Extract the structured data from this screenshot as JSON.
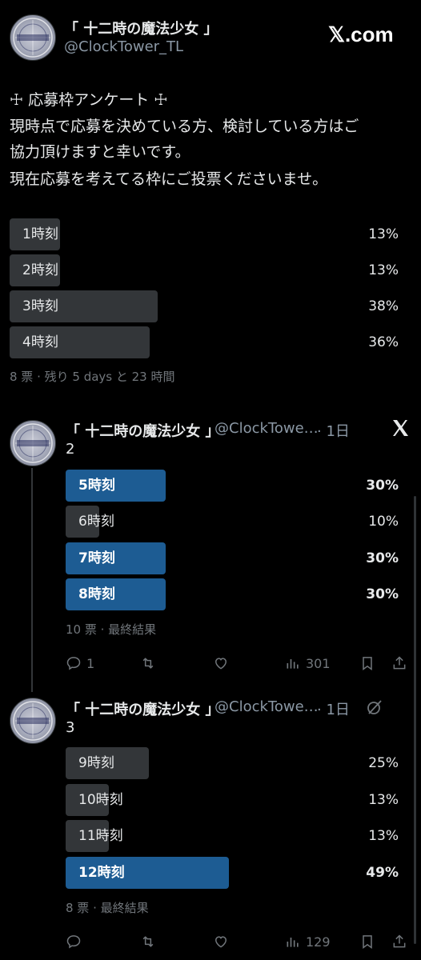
{
  "main_tweet": {
    "display_name": "「 十二時の魔法少女 」",
    "handle": "@ClockTower_TL",
    "brand": "𝕏.com",
    "text_lines": [
      "☩ 応募枠アンケート ☩",
      "現時点で応募を決めている方、検討している方はご",
      "協力頂けますと幸いです。",
      "現在応募を考えてる枠にご投票くださいませ。"
    ],
    "poll": [
      {
        "label": "1時刻",
        "percent": "13%",
        "value": 13
      },
      {
        "label": "2時刻",
        "percent": "13%",
        "value": 13
      },
      {
        "label": "3時刻",
        "percent": "38%",
        "value": 38
      },
      {
        "label": "4時刻",
        "percent": "36%",
        "value": 36
      }
    ],
    "poll_meta": "8 票 · 残り 5 days と 23 時間"
  },
  "reply1": {
    "display_name": "「 十二時の魔法少女 」",
    "handle": "@ClockTowe…",
    "time": "· 1日",
    "text": "2",
    "poll": [
      {
        "label": "5時刻",
        "percent": "30%",
        "value": 30,
        "winner": true
      },
      {
        "label": "6時刻",
        "percent": "10%",
        "value": 10,
        "winner": false
      },
      {
        "label": "7時刻",
        "percent": "30%",
        "value": 30,
        "winner": true
      },
      {
        "label": "8時刻",
        "percent": "30%",
        "value": 30,
        "winner": true
      }
    ],
    "poll_meta": "10 票 · 最終結果",
    "actions": {
      "replies": "1",
      "views": "301"
    }
  },
  "reply2": {
    "display_name": "「 十二時の魔法少女 」",
    "handle": "@ClockTowe…",
    "time": "· 1日",
    "text": "3",
    "poll": [
      {
        "label": "9時刻",
        "percent": "25%",
        "value": 25,
        "winner": false
      },
      {
        "label": "10時刻",
        "percent": "13%",
        "value": 13,
        "winner": false
      },
      {
        "label": "11時刻",
        "percent": "13%",
        "value": 13,
        "winner": false
      },
      {
        "label": "12時刻",
        "percent": "49%",
        "value": 49,
        "winner": true
      }
    ],
    "poll_meta": "8 票 · 最終結果",
    "actions": {
      "replies": "",
      "views": "129"
    }
  },
  "colors": {
    "background": "#000000",
    "poll_bar": "#333639",
    "poll_winner": "#1d5c93",
    "muted": "#71767b"
  }
}
